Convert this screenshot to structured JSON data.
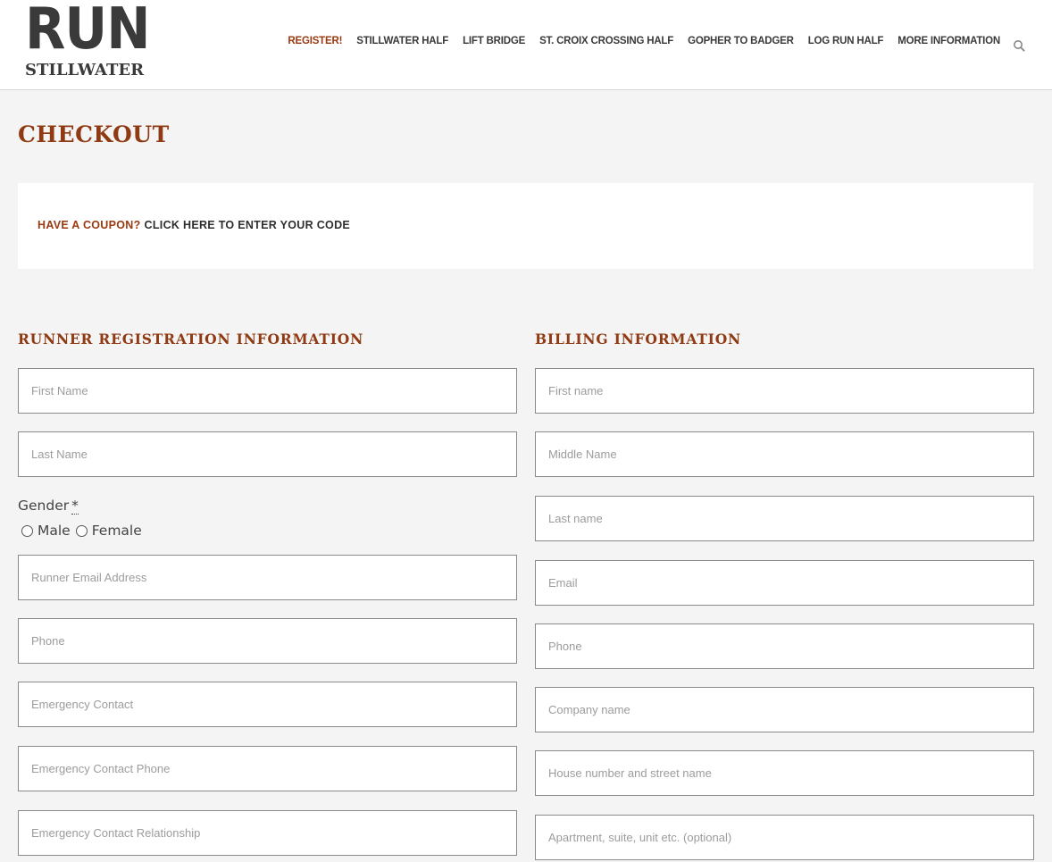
{
  "header": {
    "logo_main": "RUN",
    "logo_sub": "STILLWATER",
    "nav": [
      {
        "label": "REGISTER!",
        "active": true
      },
      {
        "label": "STILLWATER HALF",
        "active": false
      },
      {
        "label": "LIFT BRIDGE",
        "active": false
      },
      {
        "label": "ST. CROIX CROSSING HALF",
        "active": false
      },
      {
        "label": "GOPHER TO BADGER",
        "active": false
      },
      {
        "label": "LOG RUN HALF",
        "active": false
      },
      {
        "label": "MORE INFORMATION",
        "active": false
      }
    ],
    "search_icon": "search-icon"
  },
  "page": {
    "title": "CHECKOUT",
    "coupon_question": "HAVE A COUPON?",
    "coupon_link": "CLICK HERE TO ENTER YOUR CODE"
  },
  "runner": {
    "heading": "RUNNER REGISTRATION INFORMATION",
    "first_name": "First Name",
    "last_name": "Last Name",
    "gender_label": "Gender",
    "required_mark": "*",
    "gender_options": [
      "Male",
      "Female"
    ],
    "email": "Runner Email Address",
    "phone": "Phone",
    "emergency_contact": "Emergency Contact",
    "emergency_phone": "Emergency Contact Phone",
    "emergency_relationship": "Emergency Contact Relationship"
  },
  "billing": {
    "heading": "BILLING INFORMATION",
    "first_name": "First name",
    "middle_name": "Middle Name",
    "last_name": "Last name",
    "email": "Email",
    "phone": "Phone",
    "company": "Company name",
    "street": "House number and street name",
    "apartment": "Apartment, suite, unit etc. (optional)"
  },
  "colors": {
    "accent": "#8f3a12",
    "nav_active": "#9a3a10",
    "background": "#f4f4f4"
  }
}
